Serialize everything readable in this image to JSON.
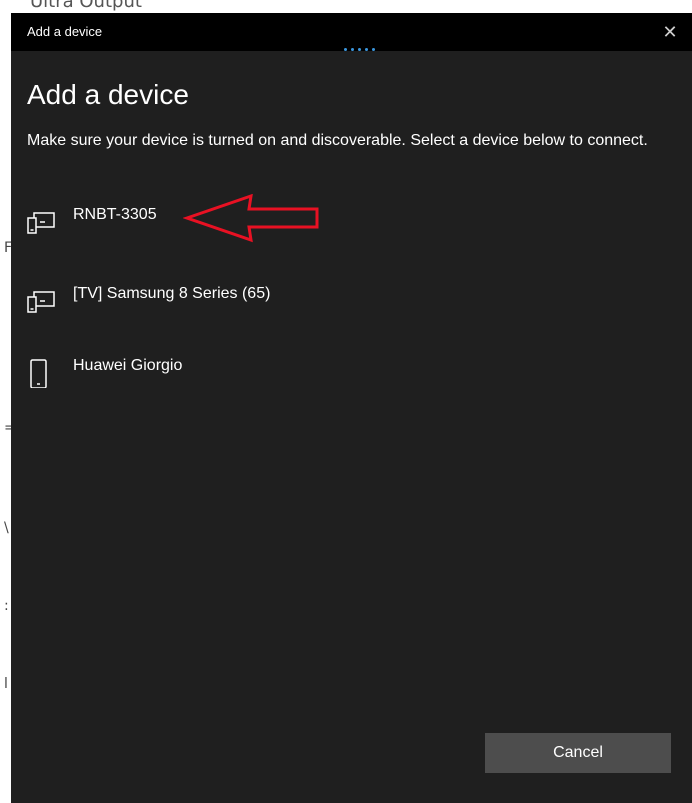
{
  "window": {
    "title": "Add a device"
  },
  "main": {
    "heading": "Add a device",
    "description": "Make sure your device is turned on and discoverable. Select a device below to connect.",
    "devices": [
      {
        "label": "RNBT-3305",
        "icon": "display-device-icon"
      },
      {
        "label": "[TV] Samsung 8 Series (65)",
        "icon": "display-device-icon"
      },
      {
        "label": "Huawei Giorgio",
        "icon": "phone-icon"
      }
    ],
    "cancel_label": "Cancel"
  },
  "colors": {
    "titlebar": "#000000",
    "dialog_bg": "#1f1f1f",
    "accent": "#3a96dd",
    "annotation_arrow": "#e81123",
    "button_bg": "#4d4d4d"
  }
}
